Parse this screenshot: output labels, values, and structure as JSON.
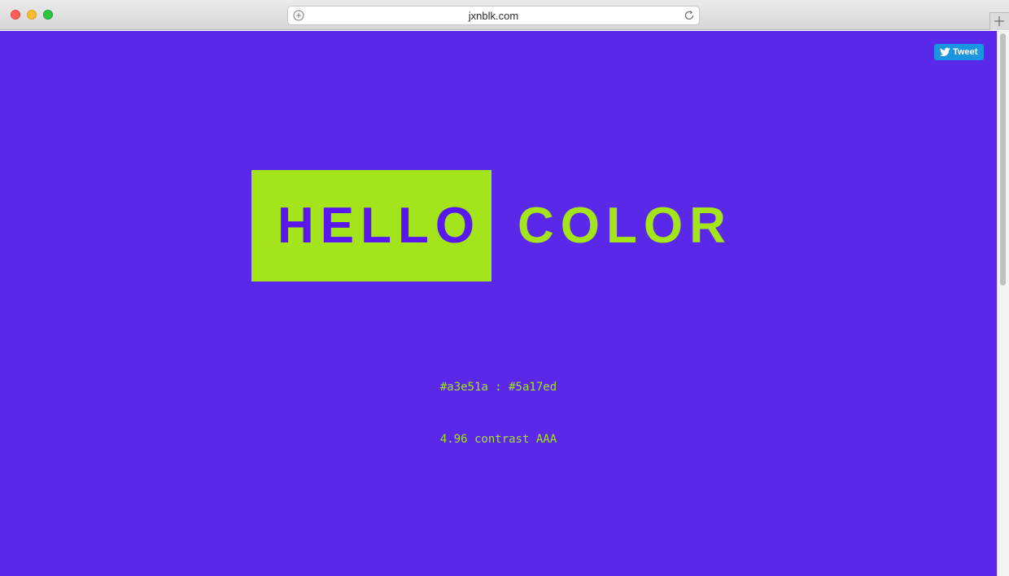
{
  "browser": {
    "url": "jxnblk.com",
    "icons": {
      "site_info": "plus-circle-icon",
      "reload": "reload-icon",
      "new_tab": "plus-icon"
    }
  },
  "page": {
    "tweet_label": "Tweet",
    "tweet_icon": "twitter-bird-icon",
    "word_one": "HELLO",
    "word_two": "COLOR",
    "hex_pair": "#a3e51a : #5a17ed",
    "contrast": "4.96 contrast AAA",
    "colors": {
      "foreground": "#a3e51a",
      "background": "#5a17ed",
      "tweet_blue": "#1b95e0"
    }
  }
}
